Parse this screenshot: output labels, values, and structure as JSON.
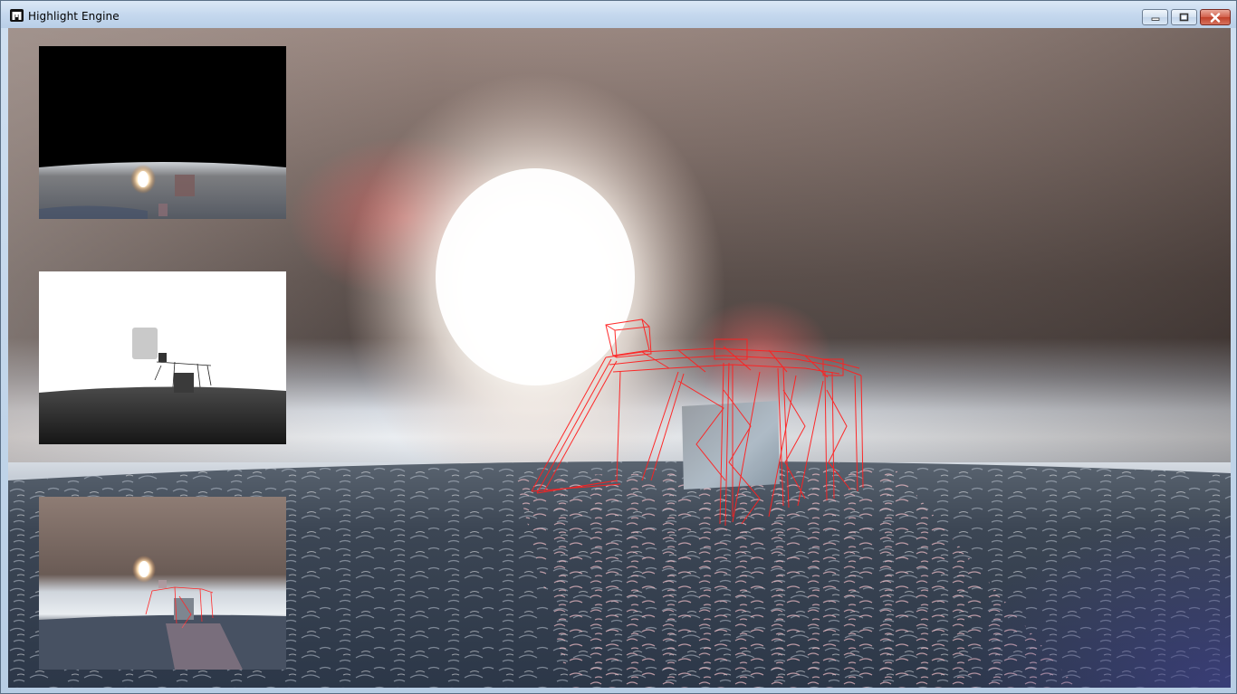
{
  "window": {
    "title": "Highlight Engine",
    "app_icon": "engine-logo-icon",
    "controls": [
      {
        "name": "minimize-button",
        "icon": "minimize-icon"
      },
      {
        "name": "maximize-button",
        "icon": "maximize-icon"
      },
      {
        "name": "close-button",
        "icon": "close-icon"
      }
    ]
  },
  "scene": {
    "description_elements": [
      "sky",
      "sun",
      "water",
      "stone-cube",
      "red-wireframe-crane"
    ],
    "colors": {
      "sky_top": "#8a7a74",
      "sky_dark": "#473c38",
      "haze": "#dfe6ee",
      "water": "#3a4452",
      "wireframe": "#ff2a2a",
      "sun": "#ffffff"
    }
  },
  "debug_views": [
    {
      "name": "reflection-buffer-preview"
    },
    {
      "name": "depth-buffer-preview"
    },
    {
      "name": "final-scene-preview"
    }
  ]
}
